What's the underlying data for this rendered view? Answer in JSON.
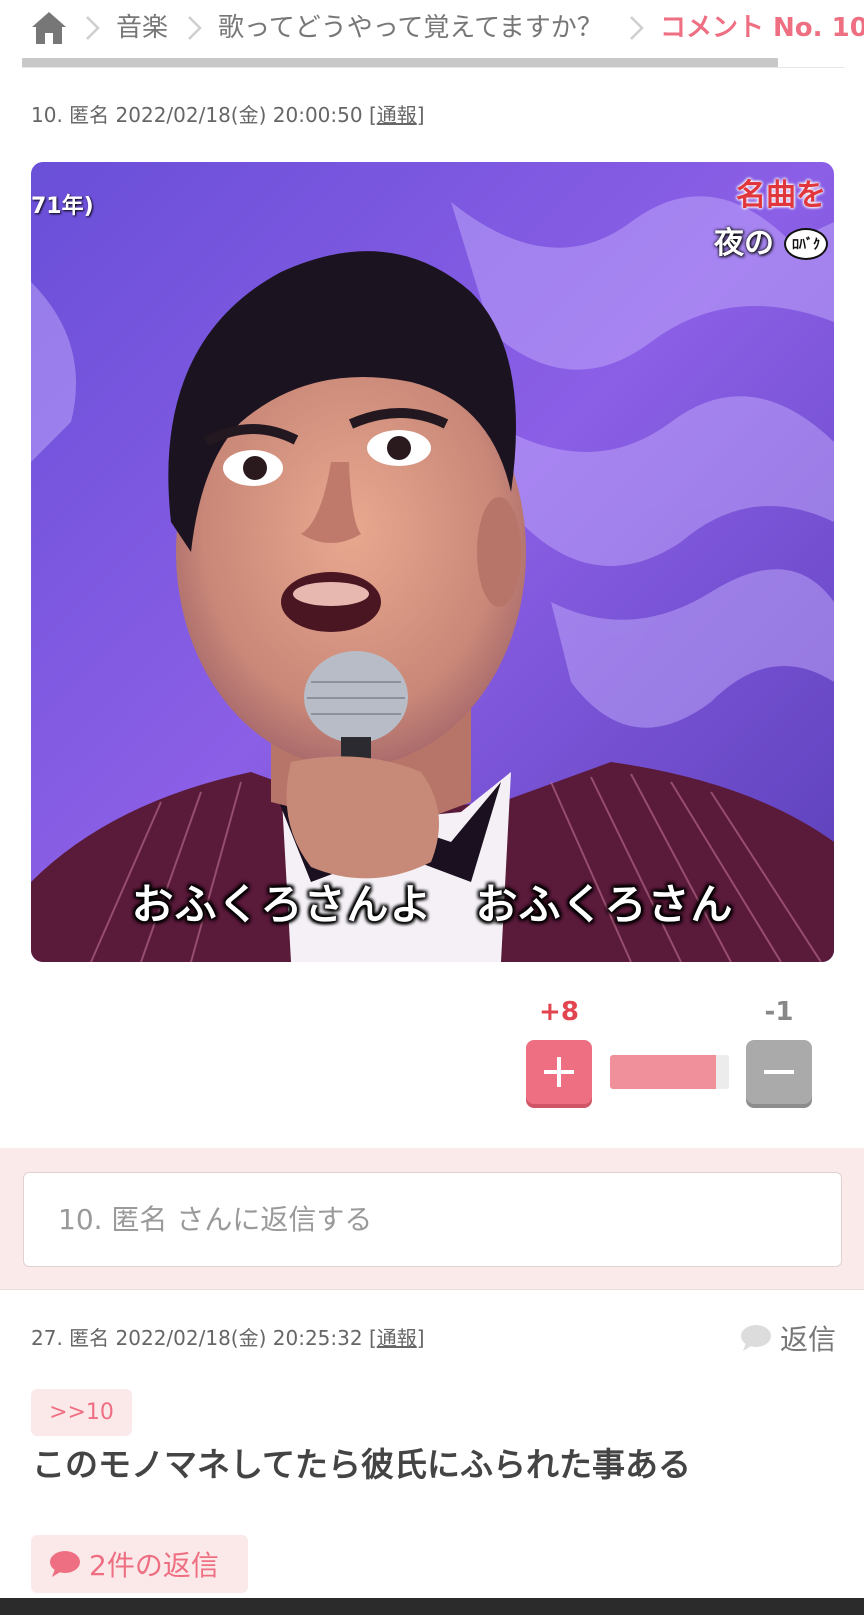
{
  "breadcrumb": {
    "home_icon": "home-icon",
    "items": [
      "音楽",
      "歌ってどうやって覚えてますか？"
    ],
    "current": "コメント No. 10"
  },
  "scroll_progress": 0.92,
  "comment": {
    "meta_prefix": "10. 匿名 2022/02/18(金) 20:00:50 [",
    "report_label": "通報",
    "meta_suffix": "]",
    "image": {
      "top_left_text": "71年)",
      "top_right_line1": "名曲を",
      "top_right_line2": "夜の",
      "top_right_badge": "ﾛﾊﾞｸ",
      "subtitle": "おふくろさんよ　おふくろさん"
    },
    "votes": {
      "plus": "+8",
      "minus": "-1",
      "plus_ratio": 0.89
    },
    "reply_input_placeholder": "10. 匿名 さんに返信する"
  },
  "reply_comment": {
    "meta_prefix": "27. 匿名 2022/02/18(金) 20:25:32 [",
    "report_label": "通報",
    "meta_suffix": "]",
    "reply_label": "返信",
    "anchor": ">>10",
    "body": "このモノマネしてたら彼氏にふられた事ある",
    "replies_count_label": "2件の返信"
  },
  "colors": {
    "accent": "#ee6f82",
    "minus_gray": "#aaaaaa",
    "band_bg": "#fbeaea"
  }
}
